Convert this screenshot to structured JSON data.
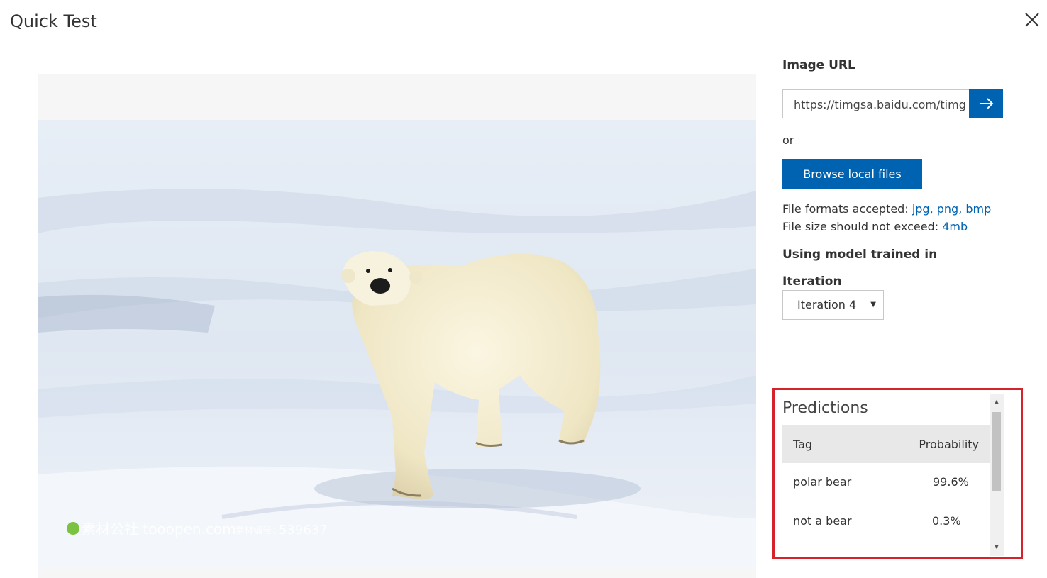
{
  "dialog": {
    "title": "Quick Test"
  },
  "image": {
    "watermark_site": "素材公社 tooopen.com",
    "watermark_id_label": "素材编号：",
    "watermark_id": "539637"
  },
  "url_section": {
    "label": "Image URL",
    "value": "https://timgsa.baidu.com/timg",
    "or_text": "or",
    "browse_label": "Browse local files",
    "formats_prefix": "File formats accepted: ",
    "formats": "jpg, png, bmp",
    "size_prefix": "File size should not exceed: ",
    "size": "4mb"
  },
  "model": {
    "heading": "Using model trained in",
    "iteration_label": "Iteration",
    "iteration_value": "Iteration 4"
  },
  "predictions": {
    "title": "Predictions",
    "columns": [
      "Tag",
      "Probability"
    ],
    "rows": [
      {
        "tag": "polar bear",
        "probability": "99.6%"
      },
      {
        "tag": "not a bear",
        "probability": "0.3%"
      }
    ]
  },
  "colors": {
    "accent": "#0063b1",
    "highlight": "#d6232b"
  }
}
